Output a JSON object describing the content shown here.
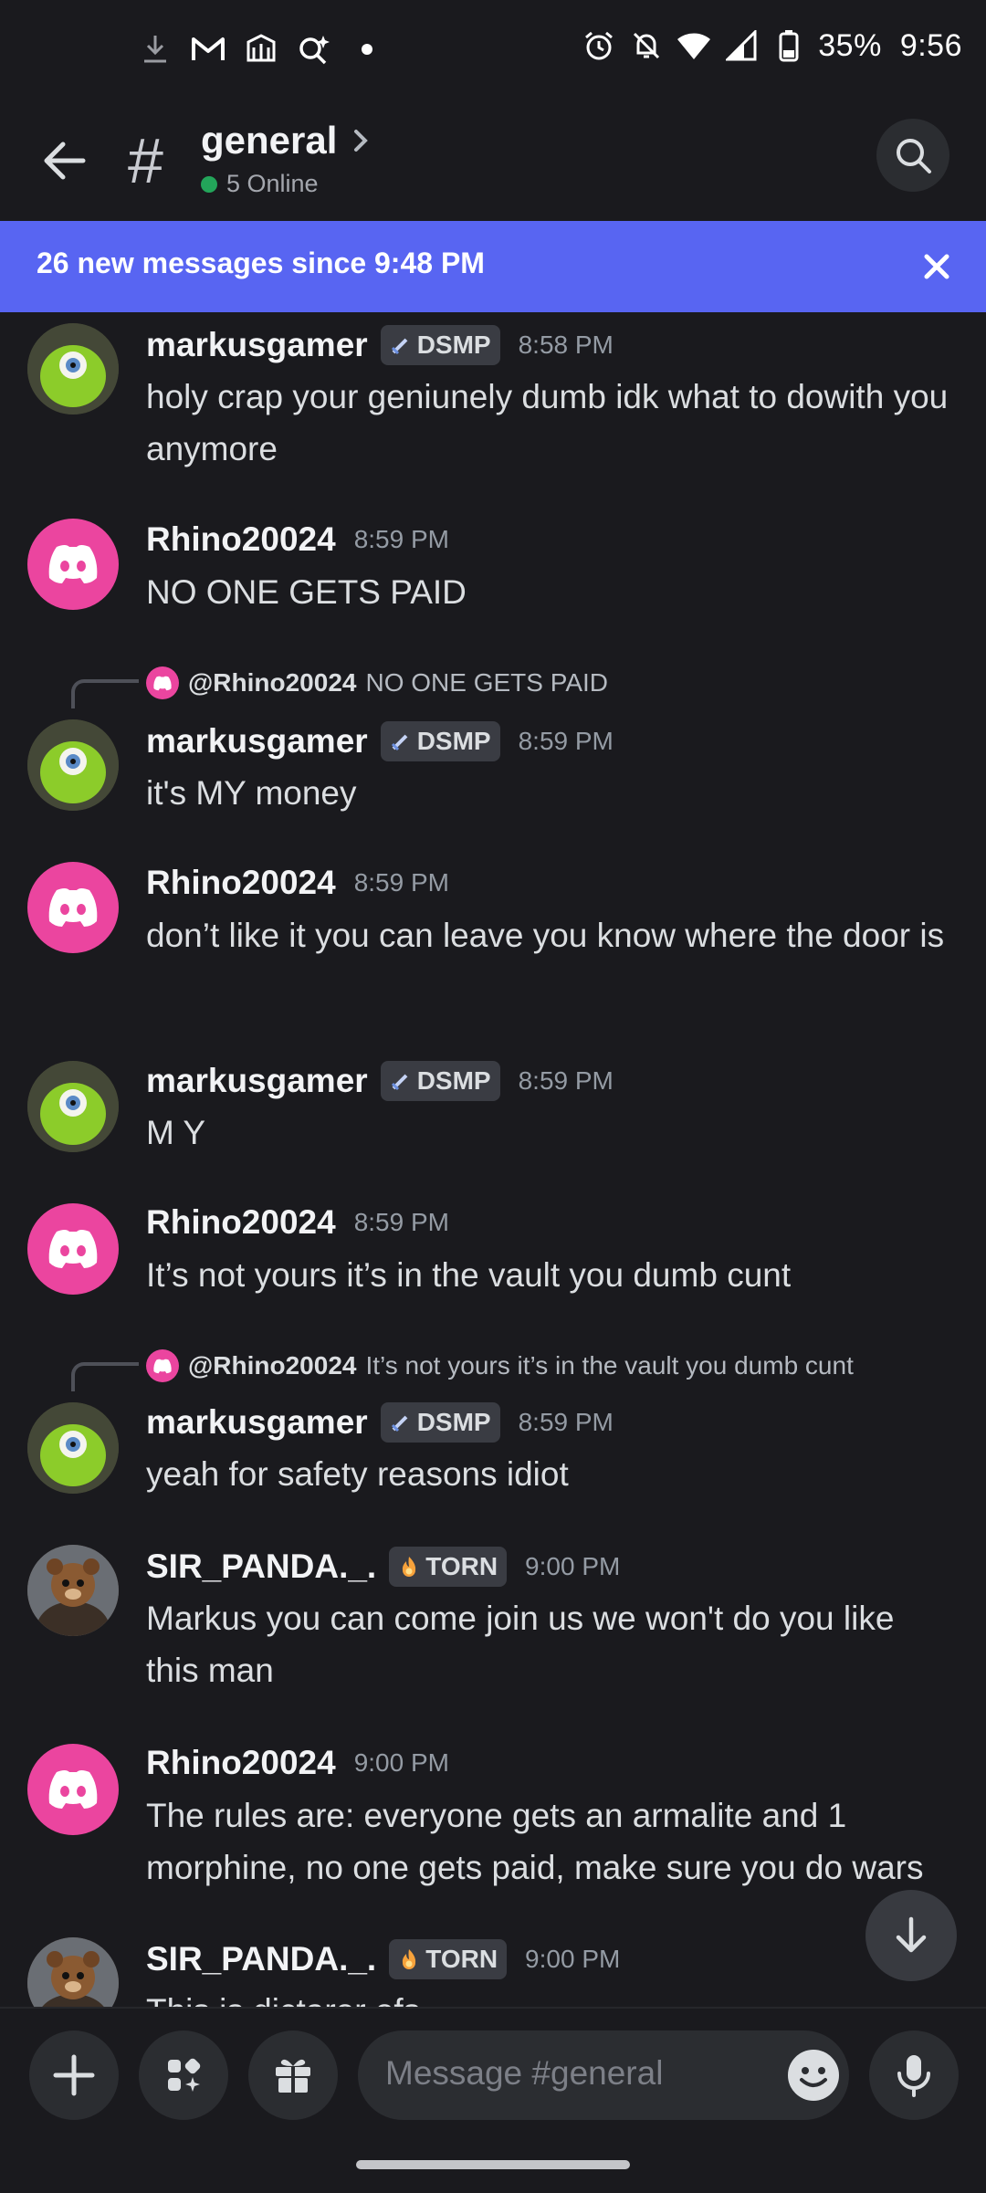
{
  "status_bar": {
    "battery": "35%",
    "time": "9:56"
  },
  "header": {
    "channel_hash": "#",
    "channel_name": "general",
    "online": "5 Online"
  },
  "banner": {
    "text": "26 new messages since 9:48 PM"
  },
  "messages": [
    {
      "author": "markusgamer",
      "tag": "DSMP",
      "time": "8:58 PM",
      "text": "holy crap your geniunely dumb idk what to dowith you anymore"
    },
    {
      "author": "Rhino20024",
      "time": "8:59 PM",
      "text": "NO ONE GETS PAID"
    },
    {
      "reply_user": "@Rhino20024",
      "reply_text": "NO ONE GETS PAID",
      "author": "markusgamer",
      "tag": "DSMP",
      "time": "8:59 PM",
      "text": "it's MY money"
    },
    {
      "author": "Rhino20024",
      "time": "8:59 PM",
      "text": "don’t like it you can leave you know where the door is"
    },
    {
      "author": "markusgamer",
      "tag": "DSMP",
      "time": "8:59 PM",
      "text": "M Y"
    },
    {
      "author": "Rhino20024",
      "time": "8:59 PM",
      "text": "It’s not yours it’s in the vault you dumb cunt"
    },
    {
      "reply_user": "@Rhino20024",
      "reply_text": "It’s not yours it’s in the vault you dumb cunt",
      "author": "markusgamer",
      "tag": "DSMP",
      "time": "8:59 PM",
      "text": "yeah for safety reasons idiot"
    },
    {
      "author": "SIR_PANDA._.",
      "tag": "TORN",
      "time": "9:00 PM",
      "text": "Markus you can come join us we won't do you like this man"
    },
    {
      "author": "Rhino20024",
      "time": "9:00 PM",
      "text": "The rules are: everyone gets an armalite and 1 morphine, no one gets paid, make sure you do wars"
    },
    {
      "author": "SIR_PANDA._.",
      "tag": "TORN",
      "time": "9:00 PM",
      "text": "This is dictaror ofs"
    }
  ],
  "composer": {
    "placeholder": "Message #general"
  },
  "icons": {
    "back": "arrow-left-icon",
    "search": "search-icon",
    "close": "close-icon",
    "jump": "arrow-down-icon",
    "add": "plus-icon",
    "apps": "apps-icon",
    "gift": "gift-icon",
    "emoji": "emoji-icon",
    "mic": "microphone-icon"
  },
  "colors": {
    "accent": "#5865f2",
    "discord_pink": "#eb459f",
    "online": "#23a55a"
  }
}
